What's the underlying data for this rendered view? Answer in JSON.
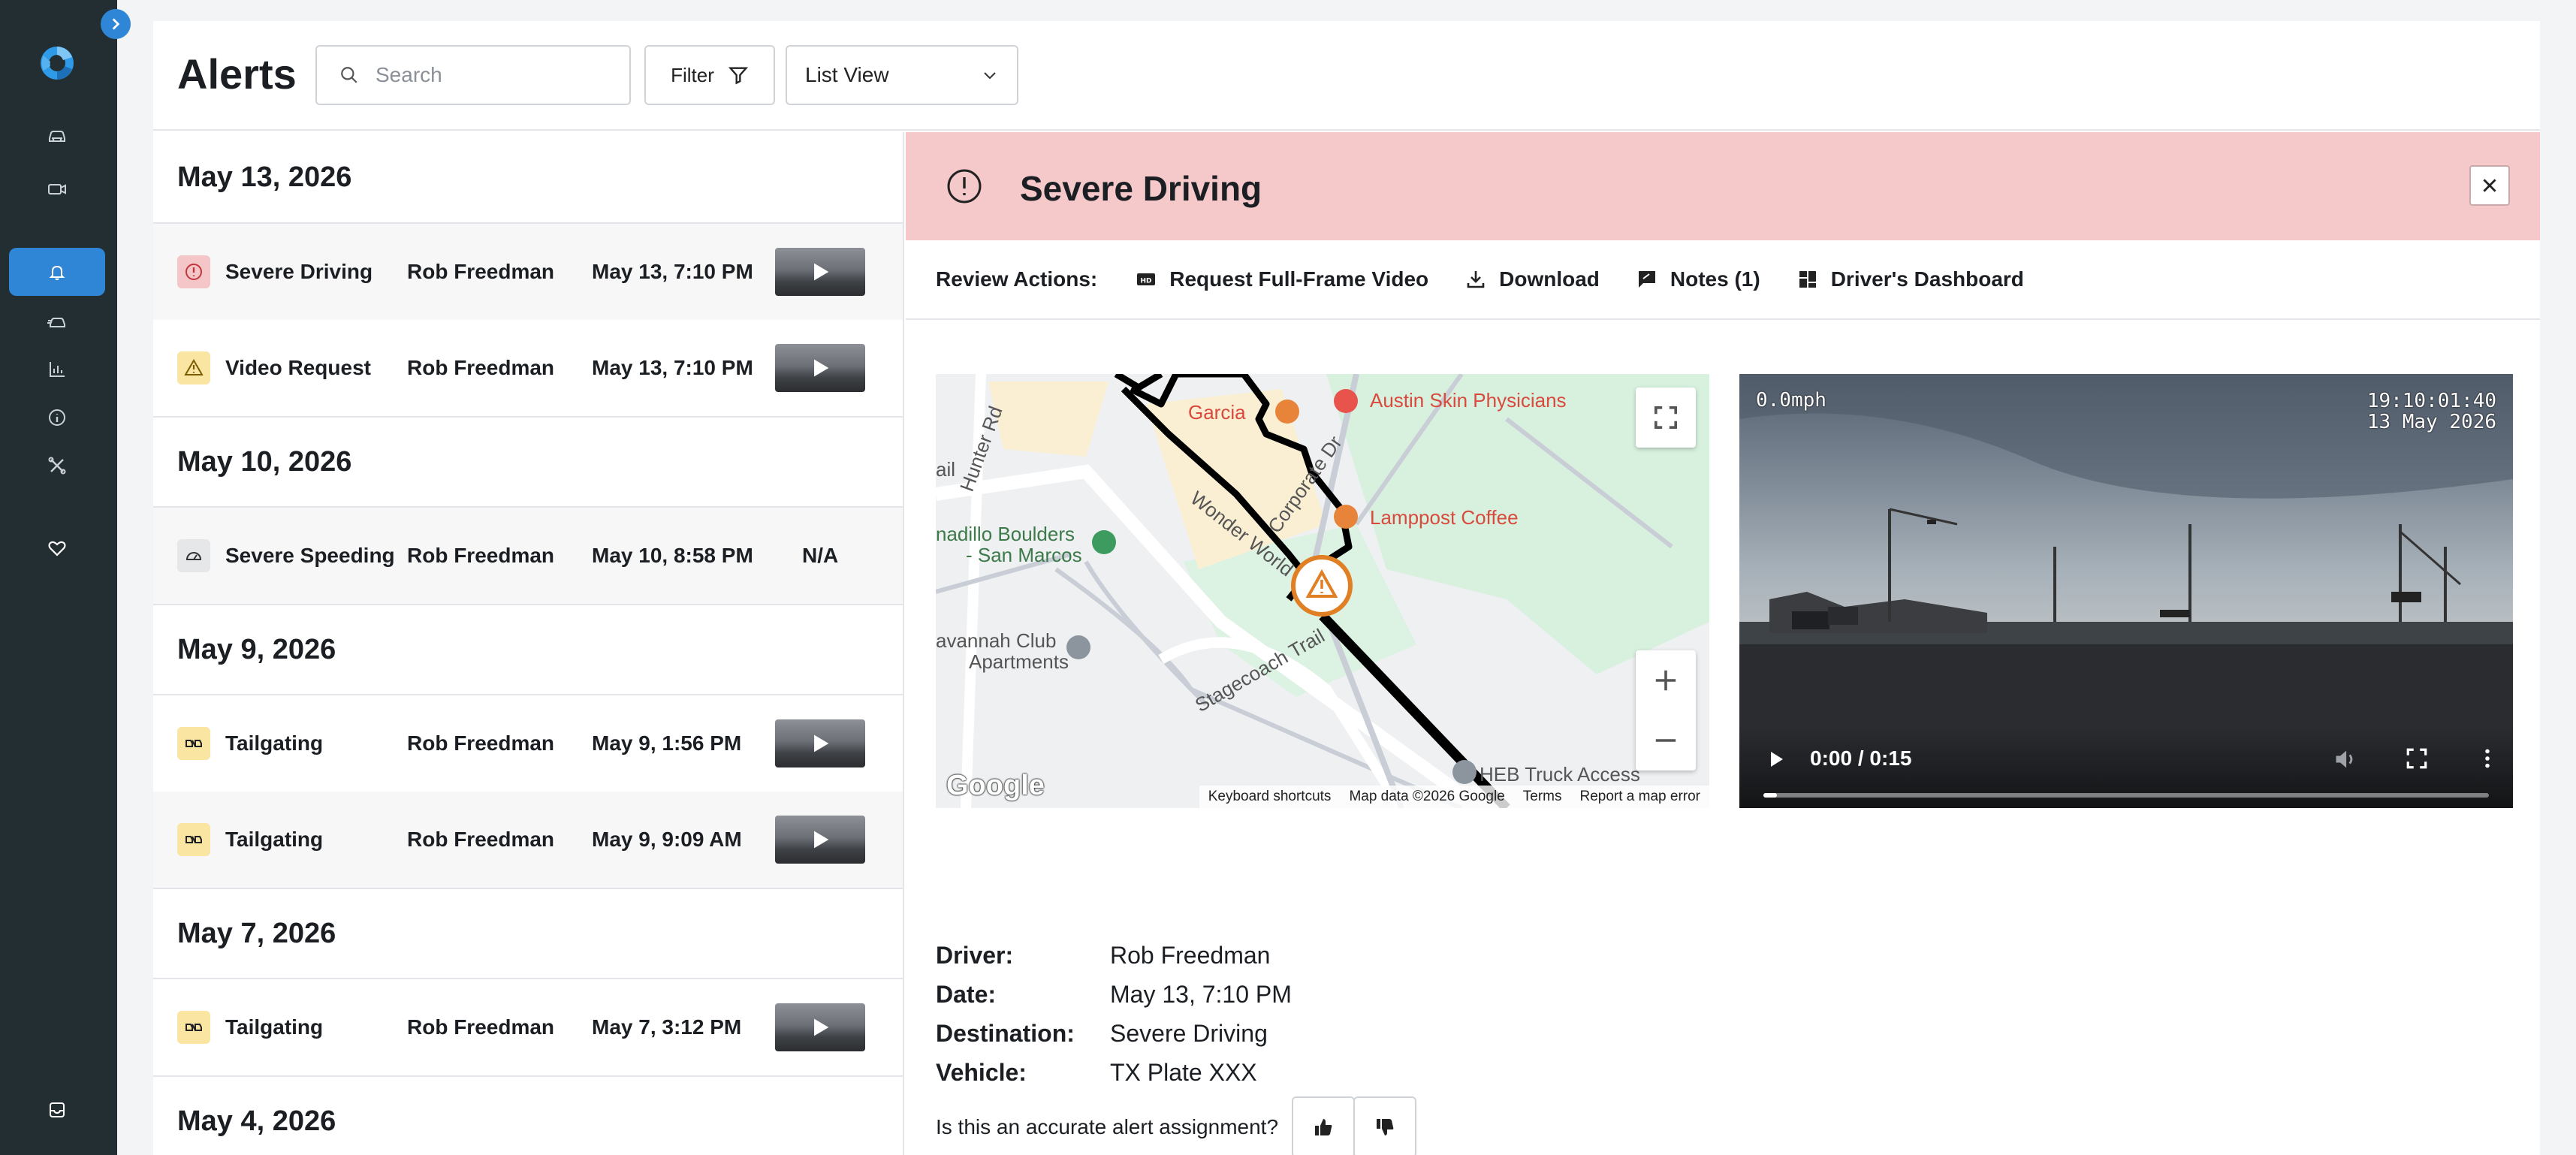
{
  "header": {
    "title": "Alerts",
    "search_placeholder": "Search",
    "filter_label": "Filter",
    "view_select": "List View"
  },
  "alert_groups": [
    {
      "date": "May 13, 2026",
      "alerts": [
        {
          "type": "Severe Driving",
          "driver": "Rob Freedman",
          "time": "May 13, 7:10 PM",
          "icon": "alert-circle-icon",
          "video": true
        },
        {
          "type": "Video Request",
          "driver": "Rob Freedman",
          "time": "May 13, 7:10 PM",
          "icon": "warning-icon",
          "video": true
        }
      ]
    },
    {
      "date": "May 10, 2026",
      "alerts": [
        {
          "type": "Severe Speeding",
          "driver": "Rob Freedman",
          "time": "May 10, 8:58 PM",
          "icon": "speedometer-icon",
          "video": false,
          "video_text": "N/A"
        }
      ]
    },
    {
      "date": "May 9, 2026",
      "alerts": [
        {
          "type": "Tailgating",
          "driver": "Rob Freedman",
          "time": "May 9, 1:56 PM",
          "icon": "tailgating-icon",
          "video": true
        },
        {
          "type": "Tailgating",
          "driver": "Rob Freedman",
          "time": "May 9, 9:09 AM",
          "icon": "tailgating-icon",
          "video": true
        }
      ]
    },
    {
      "date": "May 7, 2026",
      "alerts": [
        {
          "type": "Tailgating",
          "driver": "Rob Freedman",
          "time": "May 7, 3:12 PM",
          "icon": "tailgating-icon",
          "video": true
        }
      ]
    },
    {
      "date": "May 4, 2026",
      "alerts": []
    }
  ],
  "detail": {
    "title": "Severe Driving",
    "review_label": "Review Actions:",
    "actions": {
      "request_video": "Request Full-Frame Video",
      "download": "Download",
      "notes": "Notes (1)",
      "dashboard": "Driver's Dashboard"
    },
    "map": {
      "labels": {
        "hunter_rd": "Hunter Rd",
        "garcia": "Garcia",
        "austin_skin": "Austin Skin Physicians",
        "corporate_dr": "Corporate Dr",
        "lamppost": "Lamppost Coffee",
        "wonder_world": "Wonder World",
        "boulders_1": "nadillo Boulders",
        "boulders_2": "- San Marcos",
        "savannah_1": "avannah Club",
        "savannah_2": "Apartments",
        "stagecoach": "Stagecoach Trail",
        "heb": "HEB Truck Access",
        "ail": "ail"
      },
      "footer": {
        "shortcuts": "Keyboard shortcuts",
        "data": "Map data ©2026 Google",
        "terms": "Terms",
        "report": "Report a map error"
      },
      "logo": "Google"
    },
    "video": {
      "speed": "0.0mph",
      "clock": "19:10:01:40",
      "date": "13 May 2026",
      "time_display": "0:00 / 0:15",
      "progress": 0.0
    },
    "info": {
      "driver_label": "Driver:",
      "driver": "Rob Freedman",
      "date_label": "Date:",
      "date": "May 13, 7:10 PM",
      "destination_label": "Destination:",
      "destination": "Severe Driving",
      "vehicle_label": "Vehicle:",
      "vehicle": "TX Plate XXX"
    },
    "feedback_question": "Is this an accurate alert assignment?"
  },
  "colors": {
    "rail": "#232e33",
    "accent": "#2f86d6",
    "severe_bg": "#f5c8ca",
    "warn_bg": "#fbe5a3",
    "route": "#000000",
    "alert_marker": "#e07f24"
  }
}
